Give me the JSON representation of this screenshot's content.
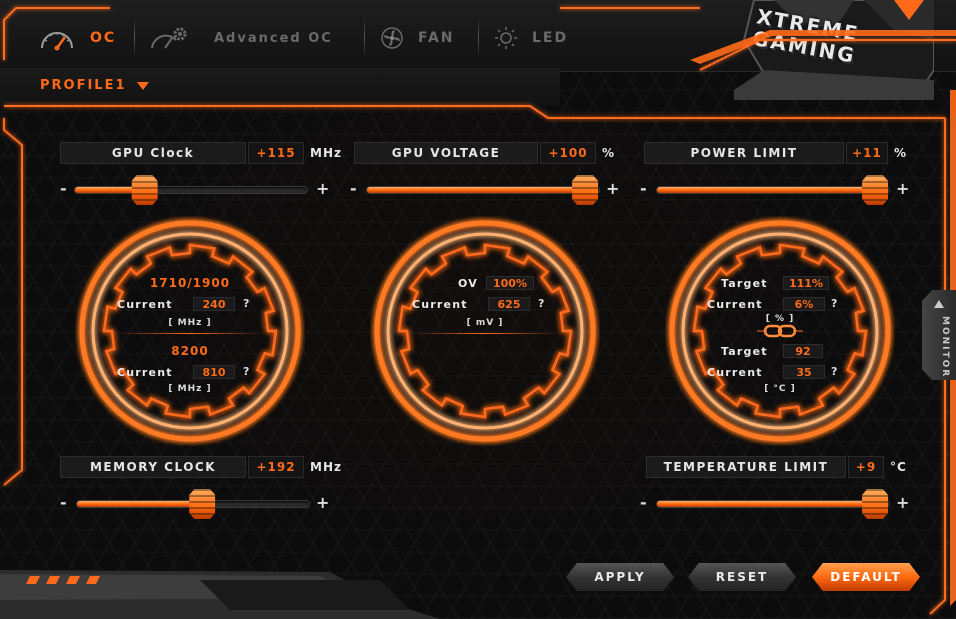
{
  "nav": {
    "tabs": [
      {
        "id": "oc",
        "label": "OC",
        "icon": "speedometer-icon",
        "active": true
      },
      {
        "id": "advanced_oc",
        "label": "Advanced OC",
        "icon": "speedometer-gear-icon",
        "active": false
      },
      {
        "id": "fan",
        "label": "FAN",
        "icon": "fan-icon",
        "active": false
      },
      {
        "id": "led",
        "label": "LED",
        "icon": "led-sun-icon",
        "active": false
      }
    ]
  },
  "logo": {
    "line1": "XTREME",
    "line2": "GAMING"
  },
  "profile": {
    "label": "PROFILE1"
  },
  "colors": {
    "accent": "#ff6a1a",
    "panel": "#1b1b1b",
    "bg": "#0c0c0c"
  },
  "params": {
    "gpu_clock": {
      "name": "GPU Clock",
      "value": "+115",
      "unit": "MHz",
      "slider": 0.3
    },
    "gpu_voltage": {
      "name": "GPU VOLTAGE",
      "value": "+100",
      "unit": "%",
      "slider": 0.94
    },
    "power_limit": {
      "name": "POWER LIMIT",
      "value": "+11",
      "unit": "%",
      "slider": 0.94
    },
    "memory_clock": {
      "name": "MEMORY CLOCK",
      "value": "+192",
      "unit": "MHz",
      "slider": 0.54
    },
    "temperature_limit": {
      "name": "TEMPERATURE LIMIT",
      "value": "+9",
      "unit": "°C",
      "slider": 0.94
    }
  },
  "slider_labels": {
    "minus": "-",
    "plus": "+"
  },
  "dials": {
    "clock": {
      "core": "1710/1900",
      "current_label": "Current",
      "core_current": "240",
      "core_unit": "[ MHz ]",
      "mem": "8200",
      "mem_current": "810",
      "mem_unit": "[ MHz ]",
      "q": "?"
    },
    "voltage": {
      "ov_label": "OV",
      "ov_value": "100%",
      "current_label": "Current",
      "current_value": "625",
      "unit": "[ mV ]",
      "q": "?"
    },
    "power": {
      "target_label": "Target",
      "target_value": "111%",
      "current_label": "Current",
      "current_value": "6%",
      "unit": "[ % ]",
      "temp_target_label": "Target",
      "temp_target_value": "92",
      "temp_current_label": "Current",
      "temp_current_value": "35",
      "temp_unit": "[ °C ]",
      "q": "?"
    }
  },
  "monitor": {
    "label": "MONITOR"
  },
  "buttons": {
    "apply": "APPLY",
    "reset": "RESET",
    "default": "DEFAULT"
  }
}
